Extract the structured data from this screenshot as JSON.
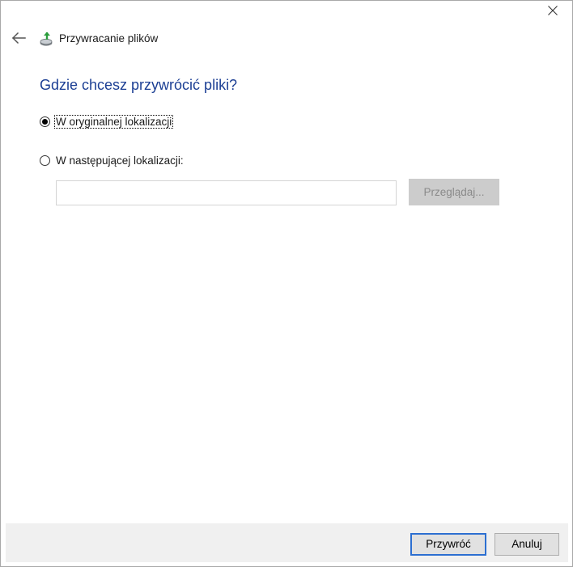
{
  "window": {
    "app_title": "Przywracanie plików",
    "close_icon": "close-icon",
    "back_icon": "back-arrow-icon",
    "app_icon": "file-restore-icon"
  },
  "main": {
    "heading": "Gdzie chcesz przywrócić pliki?",
    "options": [
      {
        "label": "W oryginalnej lokalizacji",
        "checked": true
      },
      {
        "label": "W następującej lokalizacji:",
        "checked": false
      }
    ],
    "path_input": {
      "value": "",
      "placeholder": ""
    },
    "browse_label": "Przeglądaj..."
  },
  "footer": {
    "restore_label": "Przywróć",
    "cancel_label": "Anuluj"
  },
  "colors": {
    "heading": "#1c3f94",
    "default_button_border": "#2c6fd1",
    "footer_bg": "#f0f0f0"
  }
}
